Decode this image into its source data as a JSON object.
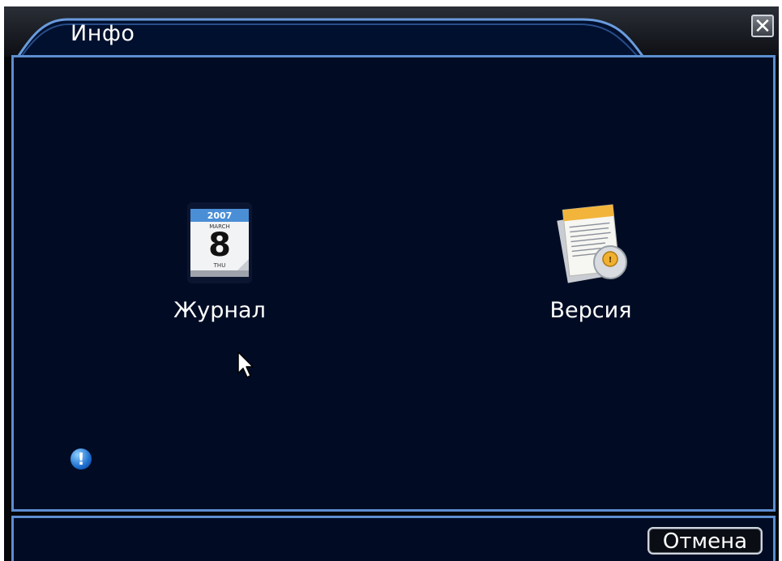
{
  "window": {
    "title": "Инфо",
    "close_label": "✕"
  },
  "items": [
    {
      "label": "Журнал",
      "icon": "calendar-icon",
      "calendar": {
        "year": "2007",
        "month": "MARCH",
        "day": "8",
        "weekday": "THU"
      }
    },
    {
      "label": "Версия",
      "icon": "version-document-icon"
    }
  ],
  "status": {
    "icon": "info-icon",
    "glyph": "!"
  },
  "footer": {
    "cancel_label": "Отмена"
  },
  "colors": {
    "panel_bg": "#010c24",
    "panel_border": "#5d8ed0",
    "text": "#ffffff",
    "window_bg": "#06070b"
  }
}
